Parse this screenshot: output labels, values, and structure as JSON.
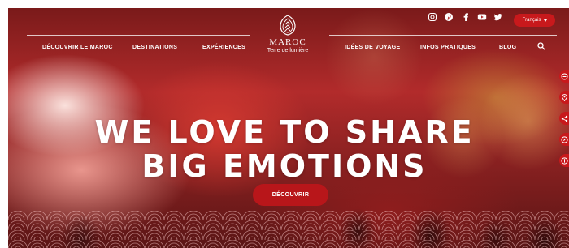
{
  "nav": {
    "left": [
      "DÉCOUVRIR LE MAROC",
      "DESTINATIONS",
      "EXPÉRIENCES"
    ],
    "right": [
      "IDÉES DE VOYAGE",
      "INFOS PRATIQUES",
      "BLOG"
    ]
  },
  "logo": {
    "title": "MAROC",
    "subtitle": "Terre de lumière"
  },
  "social": [
    "instagram-icon",
    "pinterest-icon",
    "facebook-icon",
    "youtube-icon",
    "twitter-icon"
  ],
  "language": {
    "label": "Français"
  },
  "hero": {
    "line1": "WE LOVE TO SHARE",
    "line2": "BIG EMOTIONS",
    "cta": "DÉCOUVRIR"
  },
  "side_rail": [
    "itinerary-icon",
    "map-pin-icon",
    "share-icon",
    "compass-icon",
    "info-icon"
  ],
  "colors": {
    "brand_red": "#c8191c",
    "cta_red": "#b8161a",
    "text": "#ffffff"
  }
}
